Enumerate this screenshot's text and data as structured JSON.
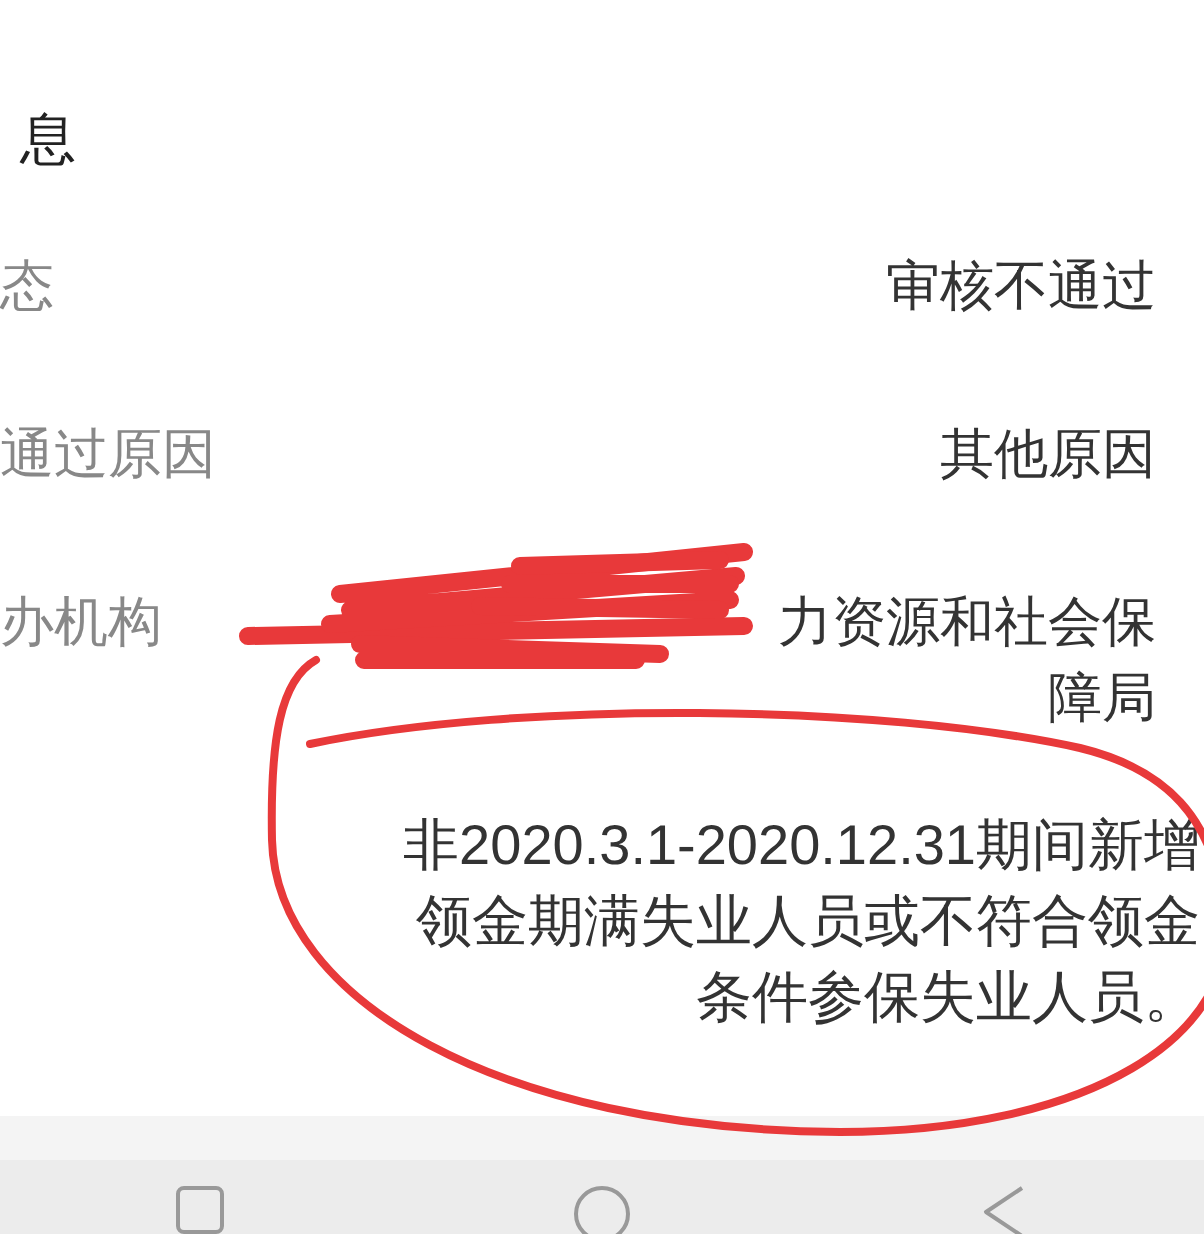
{
  "section": {
    "title": "息"
  },
  "rows": [
    {
      "label": "态",
      "value": "审核不通过"
    },
    {
      "label": "通过原因",
      "value": "其他原因"
    },
    {
      "label": "办机构",
      "value": "力资源和社会保障局"
    }
  ],
  "note": "非2020.3.1-2020.12.31期间新增领金期满失业人员或不符合领金条件参保失业人员。"
}
